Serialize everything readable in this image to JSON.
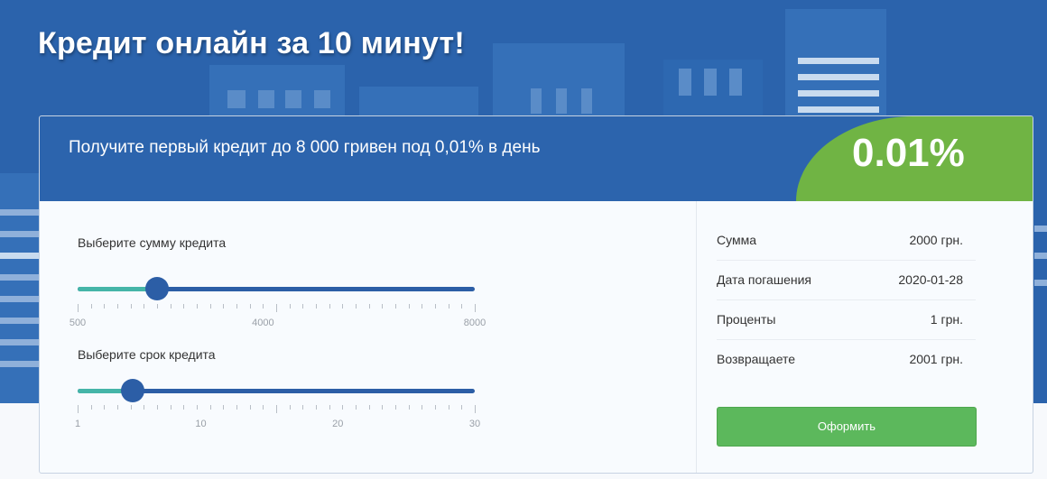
{
  "page": {
    "headline": "Кредит онлайн за 10 минут!"
  },
  "offer": {
    "promo_text": "Получите первый кредит до 8 000 гривен под 0,01% в день",
    "rate": "0.01%"
  },
  "calculator": {
    "amount": {
      "label": "Выберите сумму кредита",
      "min": 500,
      "max": 8000,
      "value": 2000,
      "tick_labels": [
        "500",
        "4000",
        "8000"
      ]
    },
    "term": {
      "label": "Выберите срок кредита",
      "min": 1,
      "max": 30,
      "value": 5,
      "tick_labels": [
        "1",
        "10",
        "20",
        "30"
      ]
    }
  },
  "summary": {
    "rows": [
      {
        "key": "Сумма",
        "value": "2000 грн."
      },
      {
        "key": "Дата погашения",
        "value": "2020-01-28"
      },
      {
        "key": "Проценты",
        "value": "1 грн."
      },
      {
        "key": "Возвращаете",
        "value": "2001 грн."
      }
    ],
    "submit_label": "Оформить"
  },
  "colors": {
    "brand_blue": "#2c64ad",
    "accent_green": "#70b444",
    "button_green": "#5cb85c",
    "slider_fill": "#45b5a8"
  }
}
